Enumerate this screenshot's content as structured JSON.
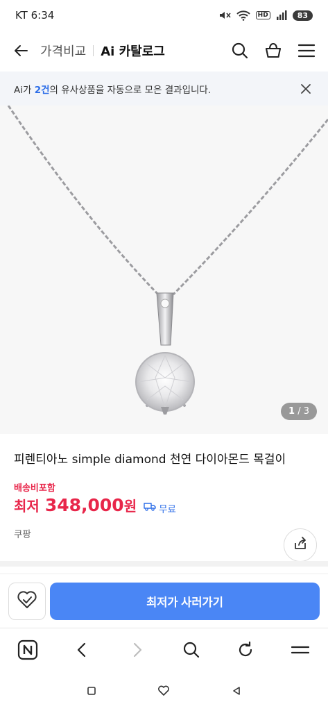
{
  "status_bar": {
    "carrier_time": "KT 6:34",
    "battery": "83",
    "hd_badge": "HD"
  },
  "header": {
    "crumb": "가격비교",
    "title": "Ai 카탈로그"
  },
  "banner": {
    "prefix": "Ai가 ",
    "count": "2건",
    "suffix": "의 유사상품을 자동으로 모은 결과입니다."
  },
  "image": {
    "current": "1",
    "separator": " / ",
    "total": "3"
  },
  "product": {
    "name": "피렌티아노 simple diamond 천연 다이아몬드 목걸이",
    "shipping_tag": "배송비포함",
    "price_label": "최저",
    "price_value": "348,000",
    "price_unit": "원",
    "delivery_label": "무료",
    "seller": "쿠팡"
  },
  "action_bar": {
    "buy_label": "최저가 사러가기"
  },
  "colors": {
    "accent": "#4a86f5",
    "price": "#e8264a",
    "link": "#2d6ee8"
  }
}
